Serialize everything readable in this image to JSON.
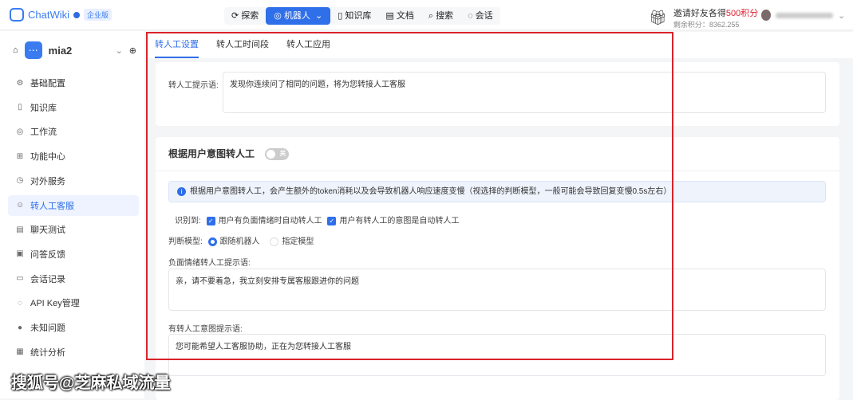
{
  "header": {
    "logo": "ChatWiki",
    "edition": "企业版",
    "nav": [
      {
        "label": "探索",
        "icon": "explore-icon"
      },
      {
        "label": "机器人",
        "icon": "robot-icon",
        "active": true
      },
      {
        "label": "知识库",
        "icon": "book-icon"
      },
      {
        "label": "文档",
        "icon": "doc-icon"
      },
      {
        "label": "搜索",
        "icon": "search-icon"
      },
      {
        "label": "会话",
        "icon": "chat-icon"
      }
    ],
    "invite_prefix": "邀请好友各得",
    "invite_highlight": "500积分",
    "points": "剩余积分：8362.255"
  },
  "sidebar": {
    "robot_name": "mia2",
    "items": [
      {
        "label": "基础配置",
        "icon": "gear-icon"
      },
      {
        "label": "知识库",
        "icon": "book-icon"
      },
      {
        "label": "工作流",
        "icon": "workflow-icon"
      },
      {
        "label": "功能中心",
        "icon": "apps-icon"
      },
      {
        "label": "对外服务",
        "icon": "service-icon"
      },
      {
        "label": "转人工客服",
        "icon": "agent-icon",
        "active": true
      },
      {
        "label": "聊天测试",
        "icon": "chat-icon"
      },
      {
        "label": "问答反馈",
        "icon": "feedback-icon"
      },
      {
        "label": "会话记录",
        "icon": "history-icon"
      },
      {
        "label": "API Key管理",
        "icon": "key-icon"
      },
      {
        "label": "未知问题",
        "icon": "question-icon"
      },
      {
        "label": "统计分析",
        "icon": "stats-icon"
      }
    ]
  },
  "tabs": [
    "转人工设置",
    "转人工时间段",
    "转人工应用"
  ],
  "prompt": {
    "label": "转人工提示语:",
    "value": "发现你连续问了相同的问题，将为您转接人工客服"
  },
  "intent": {
    "title": "根据用户意图转人工",
    "toggle": "关",
    "info": "根据用户意图转人工，会产生额外的token消耗以及会导致机器人响应速度变慢（视选择的判断模型，一般可能会导致回复变慢0.5s左右）",
    "detect_label": "识别到:",
    "detect_options": [
      "用户有负面情绪时自动转人工",
      "用户有转人工的意图是自动转人工"
    ],
    "model_label": "判断模型:",
    "model_options": [
      "跟随机器人",
      "指定模型"
    ],
    "negative_label": "负面情绪转人工提示语:",
    "negative_value": "亲，请不要着急，我立刻安排专属客服跟进你的问题",
    "intent_label": "有转人工意图提示语:",
    "intent_value": "您可能希望人工客服协助，正在为您转接人工客服"
  },
  "watermark": "搜狐号@芝麻私域流量"
}
